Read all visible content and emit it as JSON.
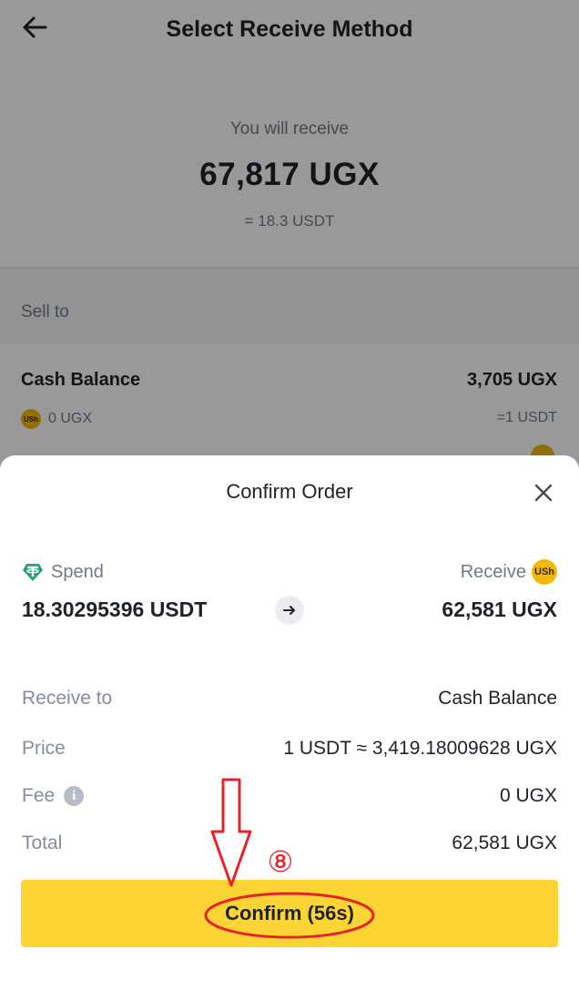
{
  "header": {
    "title": "Select Receive Method"
  },
  "summary": {
    "label": "You will receive",
    "amount": "67,817 UGX",
    "equivalent": "= 18.3 USDT"
  },
  "sell_to": {
    "label": "Sell to",
    "option": {
      "name": "Cash Balance",
      "amount": "3,705 UGX",
      "coin_badge": "USh",
      "sub_amount": "0 UGX",
      "rate": "=1 USDT"
    }
  },
  "sheet": {
    "title": "Confirm Order",
    "spend": {
      "label": "Spend",
      "amount": "18.30295396 USDT",
      "icon": "tether-icon"
    },
    "receive": {
      "label": "Receive",
      "amount": "62,581 UGX",
      "coin_badge": "USh"
    },
    "details": [
      {
        "label": "Receive to",
        "value": "Cash Balance"
      },
      {
        "label": "Price",
        "value": "1 USDT ≈ 3,419.18009628 UGX"
      },
      {
        "label": "Fee",
        "value": "0 UGX"
      },
      {
        "label": "Total",
        "value": "62,581 UGX"
      }
    ],
    "fee_info_glyph": "i",
    "confirm_label": "Confirm (56s)"
  },
  "annotation": {
    "step_number": "⑧"
  },
  "colors": {
    "accent_yellow": "#fcd535",
    "coin_gold": "#f0b90b",
    "tether_green": "#26a17b",
    "annotation_red": "#e3242b",
    "text_primary": "#1e2329",
    "text_secondary": "#707a8a"
  }
}
